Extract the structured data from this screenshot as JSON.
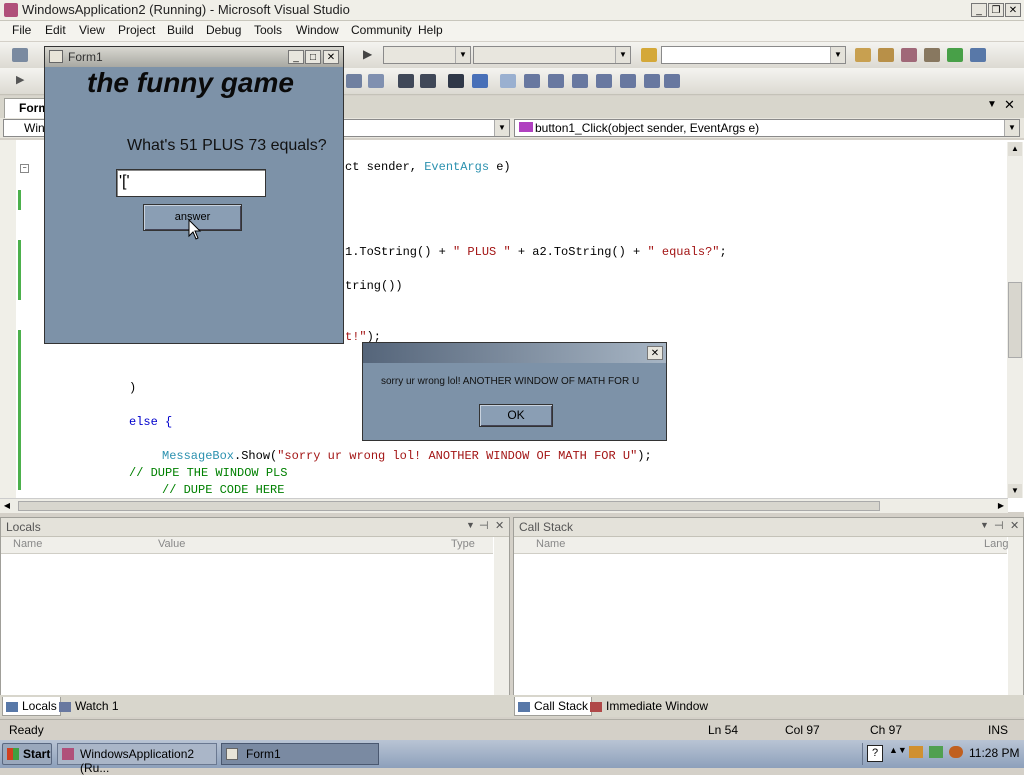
{
  "window": {
    "title": "WindowsApplication2 (Running) - Microsoft Visual Studio"
  },
  "menu": [
    "File",
    "Edit",
    "View",
    "Project",
    "Build",
    "Debug",
    "Tools",
    "Window",
    "Community",
    "Help"
  ],
  "editor": {
    "tab_label": "Form",
    "nav_left": "Wind",
    "nav_right": "button1_Click(object sender, EventArgs e)",
    "code_lines": {
      "l1a": "ct sender, ",
      "l1b": "EventArgs",
      "l1c": " e)",
      "l2a": "1.ToString() + ",
      "l2b": "\" PLUS \"",
      "l2c": " + a2.ToString() + ",
      "l2d": "\" equals?\"",
      "l2e": ";",
      "l3": "tring())",
      "l4a": "t!\"",
      "l4b": ");",
      "l5": ")",
      "l6": "else {",
      "l7a": "MessageBox",
      "l7b": ".Show(",
      "l7c": "\"sorry ur wrong lol! ANOTHER WINDOW OF MATH FOR U\"",
      "l7d": ");",
      "l8": "// DUPE THE WINDOW PLS",
      "l9": "// DUPE CODE HERE"
    }
  },
  "locals_pane": {
    "title": "Locals",
    "col_name": "Name",
    "col_value": "Value",
    "col_type": "Type"
  },
  "callstack_pane": {
    "title": "Call Stack",
    "col_name": "Name",
    "col_lang": "Lang"
  },
  "bottom_tabs_left": [
    "Locals",
    "Watch 1"
  ],
  "bottom_tabs_right": [
    "Call Stack",
    "Immediate Window"
  ],
  "status": {
    "ready": "Ready",
    "ln": "Ln 54",
    "col": "Col 97",
    "ch": "Ch 97",
    "ins": "INS"
  },
  "taskbar": {
    "start": "Start",
    "item1": "WindowsApplication2 (Ru...",
    "item2": "Form1",
    "clock": "11:28 PM"
  },
  "form1": {
    "title": "Form1",
    "heading": "the funny game",
    "question": "What's 51 PLUS 73 equals?",
    "input_value": "'['",
    "button": "answer"
  },
  "msgbox": {
    "message": "sorry ur wrong lol! ANOTHER WINDOW OF MATH FOR U",
    "ok": "OK"
  },
  "colors": {
    "form_bg": "#7d92a8",
    "keyword": "#0000cc",
    "string": "#a31515",
    "comment": "#008000",
    "type": "#2b91af"
  }
}
